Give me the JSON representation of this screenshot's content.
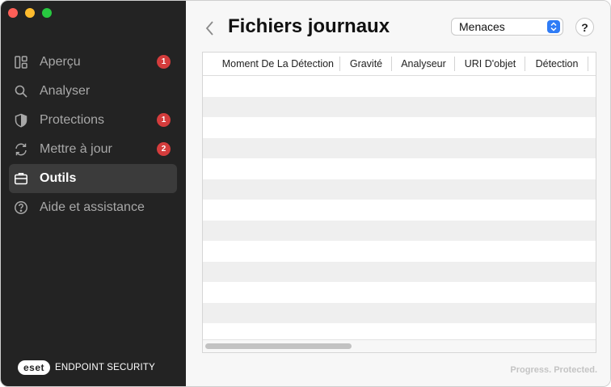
{
  "window": {
    "traffic_lights": [
      "close",
      "minimize",
      "zoom"
    ]
  },
  "sidebar": {
    "items": [
      {
        "label": "Aperçu",
        "icon": "overview-icon",
        "badge": "1",
        "active": false
      },
      {
        "label": "Analyser",
        "icon": "search-icon",
        "badge": "",
        "active": false
      },
      {
        "label": "Protections",
        "icon": "shield-icon",
        "badge": "1",
        "active": false
      },
      {
        "label": "Mettre à jour",
        "icon": "refresh-icon",
        "badge": "2",
        "active": false
      },
      {
        "label": "Outils",
        "icon": "toolbox-icon",
        "badge": "",
        "active": true
      },
      {
        "label": "Aide et assistance",
        "icon": "help-circle-icon",
        "badge": "",
        "active": false
      }
    ],
    "brand": {
      "logo": "eset",
      "product": "ENDPOINT SECURITY"
    }
  },
  "header": {
    "title": "Fichiers journaux",
    "log_type_select": {
      "value": "Menaces"
    },
    "help_label": "?"
  },
  "table": {
    "columns": [
      "Moment De La Détection",
      "Gravité",
      "Analyseur",
      "URI D'objet",
      "Détection"
    ],
    "rows": []
  },
  "footer": {
    "tagline": "Progress. Protected."
  },
  "colors": {
    "sidebar_bg": "#232323",
    "badge": "#d43c3c",
    "accent": "#2f7cf6"
  }
}
